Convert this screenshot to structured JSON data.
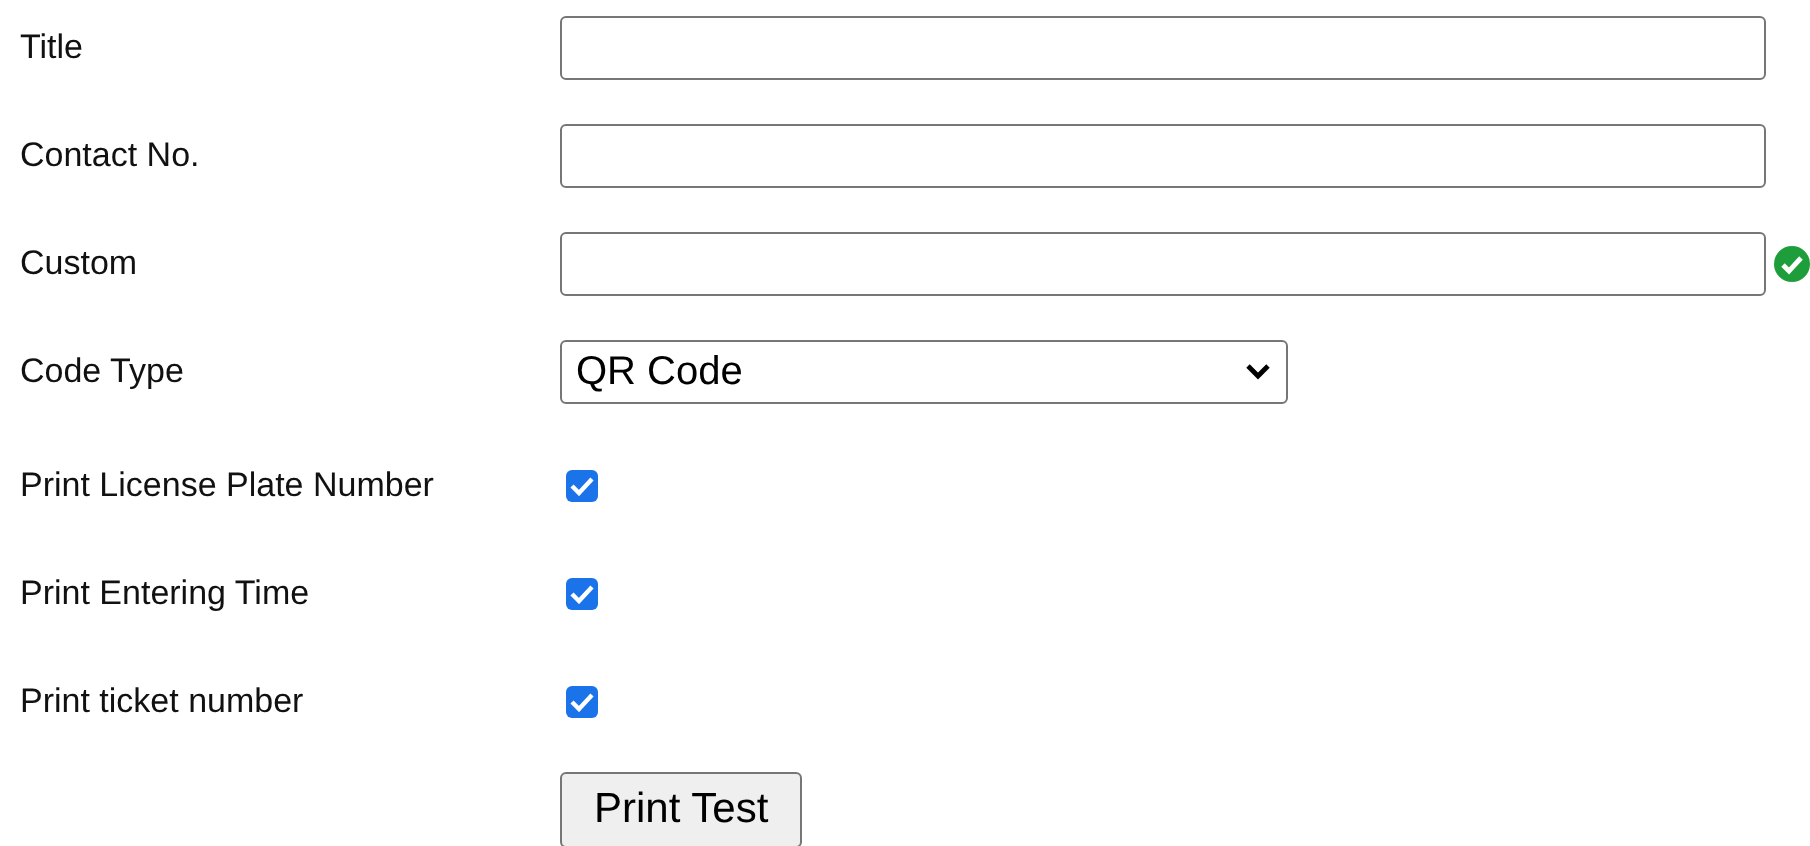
{
  "fields": [
    {
      "kind": "text",
      "label": "Title",
      "valid": false
    },
    {
      "kind": "text",
      "label": "Contact No.",
      "valid": false
    },
    {
      "kind": "text",
      "label": "Custom",
      "valid": true
    },
    {
      "kind": "select",
      "label": "Code Type",
      "value": "QR Code"
    },
    {
      "kind": "checkbox",
      "label": "Print License Plate Number",
      "checked": true
    },
    {
      "kind": "checkbox",
      "label": "Print Entering Time",
      "checked": true
    },
    {
      "kind": "checkbox",
      "label": "Print ticket number",
      "checked": true
    }
  ],
  "button": "Print Test"
}
